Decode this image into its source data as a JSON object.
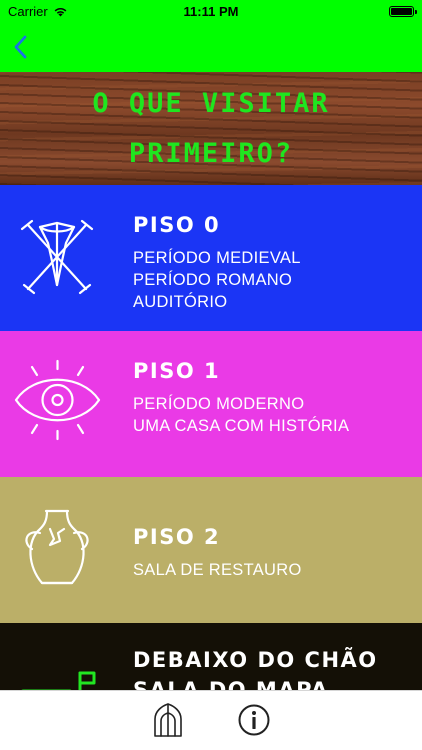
{
  "status_bar": {
    "carrier": "Carrier",
    "time": "11:11 PM",
    "wifi_icon": "wifi-icon",
    "battery_icon": "battery-icon"
  },
  "nav": {
    "back_icon": "chevron-left-icon"
  },
  "header": {
    "title_line1": "O QUE VISITAR",
    "title_line2": "PRIMEIRO?"
  },
  "floors": [
    {
      "title": "PISO 0",
      "icon": "shield-swords-icon",
      "lines": [
        "PERÍODO MEDIEVAL",
        "PERÍODO ROMANO",
        "AUDITÓRIO"
      ]
    },
    {
      "title": "PISO 1",
      "icon": "eye-icon",
      "lines": [
        "PERÍODO MODERNO",
        "UMA CASA COM HISTÓRIA"
      ]
    },
    {
      "title": "PISO 2",
      "icon": "broken-vase-icon",
      "lines": [
        "SALA DE RESTAURO"
      ]
    },
    {
      "title": "DEBAIXO DO CHÃO",
      "title2": "SALA DO MAPA",
      "icon": "map-flag-icon"
    }
  ],
  "tab_bar": {
    "items": [
      "cathedral-icon",
      "info-icon"
    ]
  },
  "colors": {
    "status_nav": "#00ff00",
    "header_title": "#1fe61f",
    "piso0": "#1b35f5",
    "piso1": "#ea3ae6",
    "piso2": "#bbaf68",
    "basement": "#141006",
    "basement_icon": "#22e622"
  }
}
